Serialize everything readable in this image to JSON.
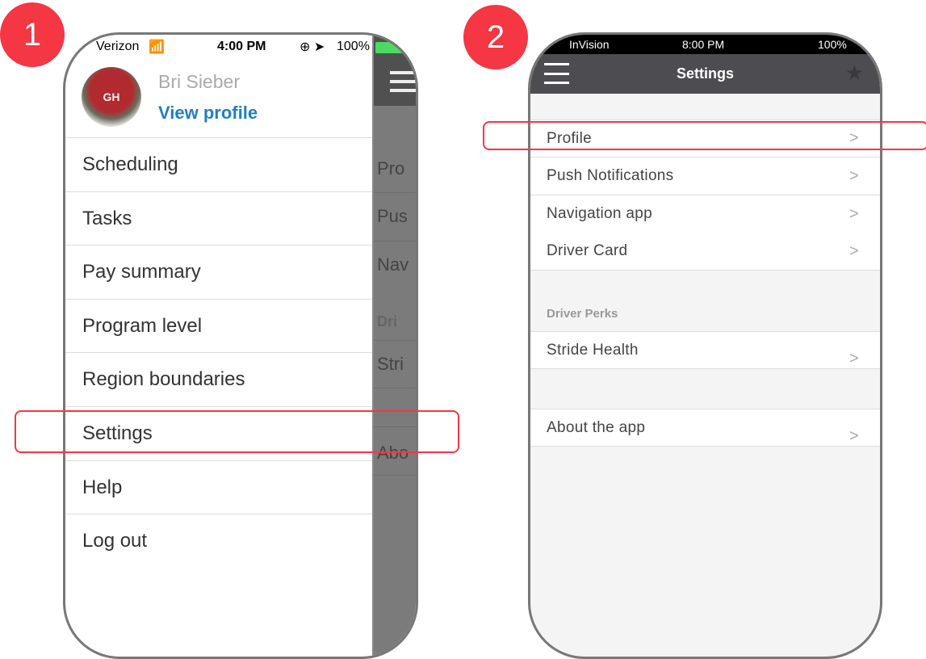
{
  "badges": [
    "1",
    "2"
  ],
  "screen1": {
    "status": {
      "carrier": "Verizon",
      "time": "4:00 PM",
      "battery": "100%"
    },
    "user": {
      "name": "Bri Sieber",
      "link": "View profile",
      "avatar_text": "GH"
    },
    "menu": [
      "Scheduling",
      "Tasks",
      "Pay summary",
      "Program level",
      "Region boundaries",
      "Settings",
      "Help",
      "Log out"
    ],
    "behind": [
      "Pro",
      "Pus",
      "Nav",
      "Dri",
      "Stri",
      "Abo"
    ],
    "highlighted": "Settings"
  },
  "screen2": {
    "status": {
      "carrier": "InVision",
      "time": "8:00 PM",
      "battery": "100%"
    },
    "title": "Settings",
    "items": [
      "Profile",
      "Push Notifications",
      "Navigation app",
      "Driver Card"
    ],
    "section": "Driver Perks",
    "perks": [
      "Stride Health"
    ],
    "about": "About the app",
    "highlighted": "Profile"
  },
  "colors": {
    "accent": "#f53643",
    "link": "#1f7fc0",
    "header": "#4d4c50"
  }
}
